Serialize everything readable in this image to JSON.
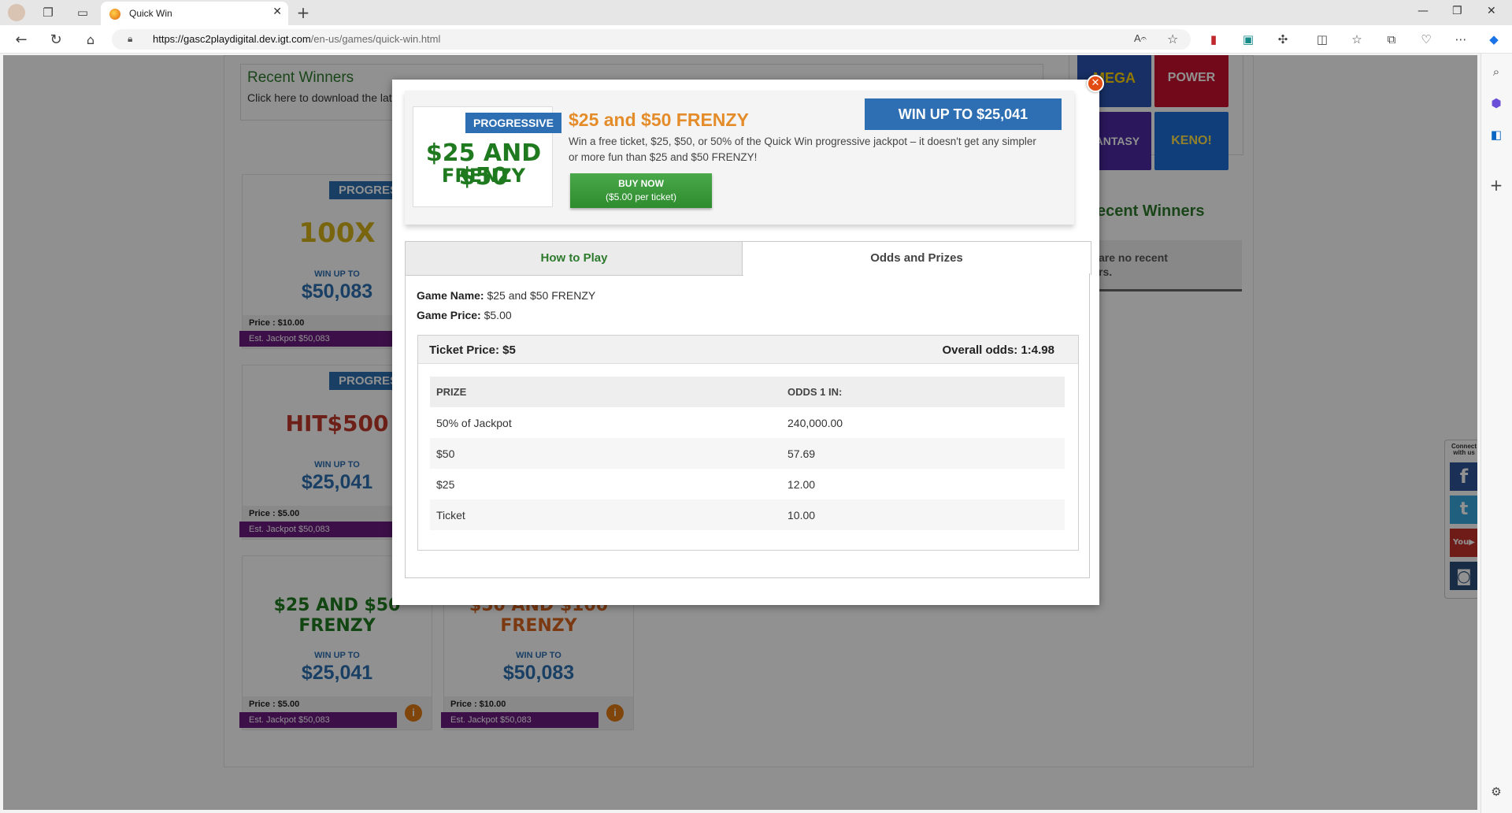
{
  "browser": {
    "tab_title": "Quick Win",
    "url_domain": "https://gasc2playdigital.dev.igt.com",
    "url_path": "/en-us/games/quick-win.html"
  },
  "page": {
    "recent_winners_title": "Recent Winners",
    "recent_winners_sub": "Click here to download the lat",
    "recent_winners_right": "ecent Winners",
    "no_recent": "are no recent",
    "no_recent2": "rs.",
    "social_label": "Connect with us",
    "cards": [
      {
        "prog": "PROGRES",
        "logo": "100X",
        "win_label": "WIN UP TO",
        "amount": "$50,083",
        "price": "Price : $10.00",
        "jackpot": "Est. Jackpot $50,083"
      },
      {
        "prog": "PROGRES",
        "logo": "HIT$500",
        "win_label": "WIN UP TO",
        "amount": "$25,041",
        "price": "Price : $5.00",
        "jackpot": "Est. Jackpot $50,083"
      },
      {
        "logo": "$25 AND $50 FRENZY",
        "win_label": "WIN UP TO",
        "amount": "$25,041",
        "price": "Price : $5.00",
        "jackpot": "Est. Jackpot $50,083"
      },
      {
        "logo": "$50 AND $100 FRENZY",
        "win_label": "WIN UP TO",
        "amount": "$50,083",
        "price": "Price : $10.00",
        "jackpot": "Est. Jackpot $50,083"
      }
    ],
    "tiles": [
      "MEGA",
      "POWER",
      "FANTASY",
      "KENO!"
    ]
  },
  "modal": {
    "progressive_tag": "PROGRESSIVE",
    "logo_line1": "$25 AND $50",
    "logo_line2": "FRENZY",
    "game_title": "$25 and $50 FRENZY",
    "description": "Win a free ticket, $25, $50, or 50% of the Quick Win progressive jackpot – it doesn't get any simpler or more fun than $25 and $50 FRENZY!",
    "buy_now": "BUY NOW",
    "buy_price": "($5.00 per ticket)",
    "win_up_to": "WIN UP TO $25,041",
    "tabs": [
      "How to Play",
      "Odds and Prizes"
    ],
    "game_name_label": "Game Name:",
    "game_name": "$25 and $50 FRENZY",
    "game_price_label": "Game Price:",
    "game_price": "$5.00",
    "ticket_price": "Ticket Price: $5",
    "overall_odds": "Overall odds: 1:4.98",
    "table_headers": [
      "PRIZE",
      "ODDS 1 IN:"
    ],
    "rows": [
      {
        "prize": "50% of Jackpot",
        "odds": "240,000.00"
      },
      {
        "prize": "$50",
        "odds": "57.69"
      },
      {
        "prize": "$25",
        "odds": "12.00"
      },
      {
        "prize": "Ticket",
        "odds": "10.00"
      }
    ]
  },
  "colors": {
    "green": "#2d7a2d",
    "blue": "#2d6fb2",
    "orange": "#e58c2a",
    "purple": "#6a1b7f"
  }
}
